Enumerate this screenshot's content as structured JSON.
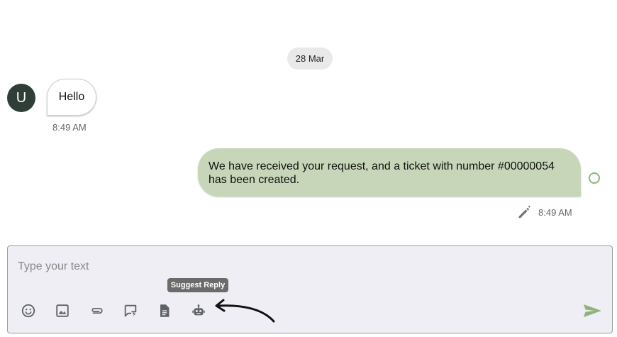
{
  "conversation": {
    "date_divider": "28 Mar",
    "incoming": {
      "avatar_initial": "U",
      "text": "Hello",
      "time": "8:49 AM"
    },
    "outgoing": {
      "text": "We have received your request, and a ticket with number #00000054 has been created.",
      "time": "8:49 AM"
    }
  },
  "composer": {
    "placeholder": "Type your text",
    "tooltip": "Suggest Reply",
    "tools": [
      "emoji-icon",
      "image-icon",
      "attachment-icon",
      "quick-reply-icon",
      "template-icon",
      "robot-icon"
    ],
    "send_icon": "send-icon"
  },
  "colors": {
    "outgoing_bubble": "#c7d6b9",
    "avatar": "#2f3f38",
    "send": "#8fb37d",
    "composer_bg": "#eeeef4"
  }
}
